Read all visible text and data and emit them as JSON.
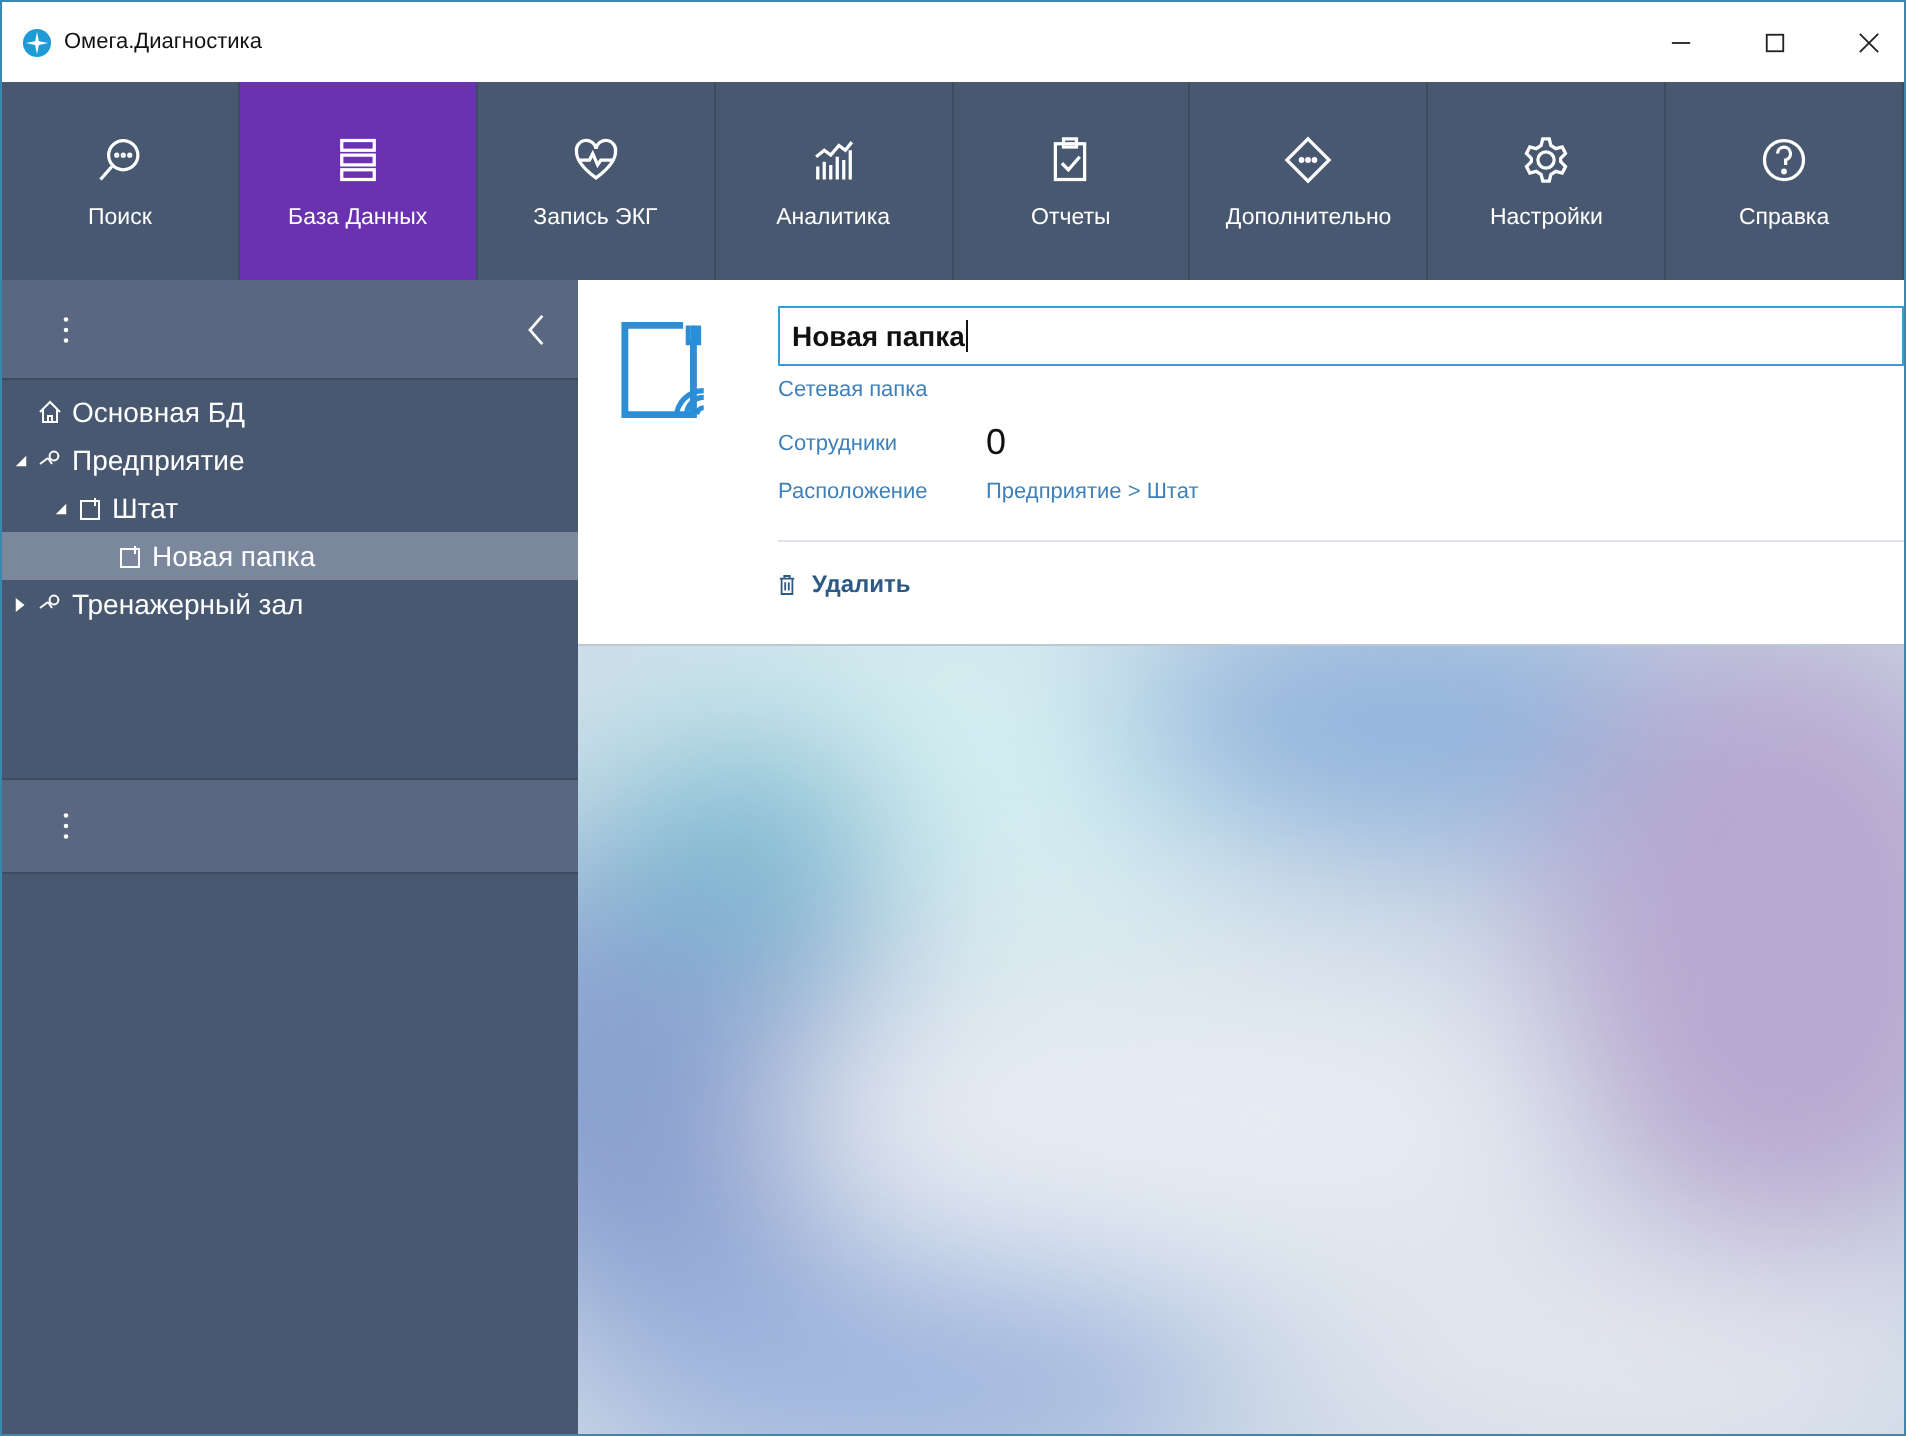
{
  "window": {
    "title": "Омега.Диагностика"
  },
  "tabs": [
    {
      "label": "Поиск",
      "kind": "search",
      "selected": false
    },
    {
      "label": "База Данных",
      "kind": "database",
      "selected": true
    },
    {
      "label": "Запись ЭКГ",
      "kind": "heart",
      "selected": false
    },
    {
      "label": "Аналитика",
      "kind": "chart",
      "selected": false
    },
    {
      "label": "Отчеты",
      "kind": "report",
      "selected": false
    },
    {
      "label": "Дополнительно",
      "kind": "more",
      "selected": false
    },
    {
      "label": "Настройки",
      "kind": "settings",
      "selected": false
    },
    {
      "label": "Справка",
      "kind": "help",
      "selected": false
    }
  ],
  "sidebar": {
    "tree": [
      {
        "label": "Основная БД",
        "kind": "home",
        "selected": false
      },
      {
        "label": "Предприятие",
        "kind": "org",
        "selected": false,
        "expanded": true,
        "children": [
          {
            "label": "Штат",
            "kind": "folder",
            "selected": false,
            "expanded": true,
            "children": [
              {
                "label": "Новая папка",
                "kind": "folder",
                "selected": true
              }
            ]
          }
        ]
      },
      {
        "label": "Тренажерный зал",
        "kind": "org",
        "selected": false,
        "expanded": false
      }
    ]
  },
  "details": {
    "name": "Новая папка",
    "type": "Сетевая папка",
    "fields": [
      {
        "label": "Сотрудники",
        "value": "0",
        "kind": "count"
      },
      {
        "label": "Расположение",
        "value": "Предприятие > Штат",
        "kind": "link"
      }
    ],
    "delete_button": "Удалить"
  }
}
